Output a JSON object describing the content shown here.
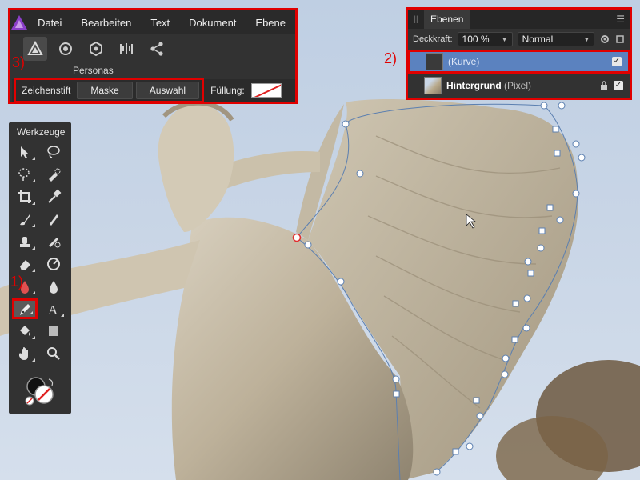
{
  "menu": {
    "items": [
      "Datei",
      "Bearbeiten",
      "Text",
      "Dokument",
      "Ebene"
    ]
  },
  "personas": {
    "label": "Personas",
    "icons": [
      "designer-persona-icon",
      "pixel-persona-icon",
      "export-persona-icon",
      "tone-mapping-persona-icon",
      "share-icon"
    ]
  },
  "context": {
    "tool_name": "Zeichenstift",
    "mask_label": "Maske",
    "selection_label": "Auswahl",
    "fill_label": "Füllung:"
  },
  "layers": {
    "tab_label": "Ebenen",
    "opacity_label": "Deckkraft:",
    "opacity_value": "100 %",
    "blend_mode": "Normal",
    "rows": [
      {
        "name": "",
        "sub": "(Kurve)",
        "selected": true,
        "checked": true
      },
      {
        "name": "Hintergrund",
        "sub": "(Pixel)",
        "selected": false,
        "checked": true,
        "locked": true
      }
    ]
  },
  "tools": {
    "title": "Werkzeuge",
    "items": [
      "move-icon",
      "lasso-select-icon",
      "freehand-select-icon",
      "selection-brush-icon",
      "crop-icon",
      "color-picker-icon",
      "paint-brush-icon",
      "pixel-brush-icon",
      "clone-stamp-icon",
      "healing-brush-icon",
      "eraser-icon",
      "dodge-icon",
      "flood-fill-icon",
      "blur-drop-icon",
      "pen-icon",
      "text-icon",
      "fill-bucket-icon",
      "rectangle-shape-icon",
      "hand-icon",
      "zoom-icon"
    ],
    "active_index": 14
  },
  "callouts": {
    "one": "1)",
    "two": "2)",
    "three": "3)"
  },
  "colors": {
    "highlight": "#e00000",
    "selected_layer": "#5b82bf",
    "panel_bg": "#323232",
    "sky": "#c8d5e6"
  }
}
